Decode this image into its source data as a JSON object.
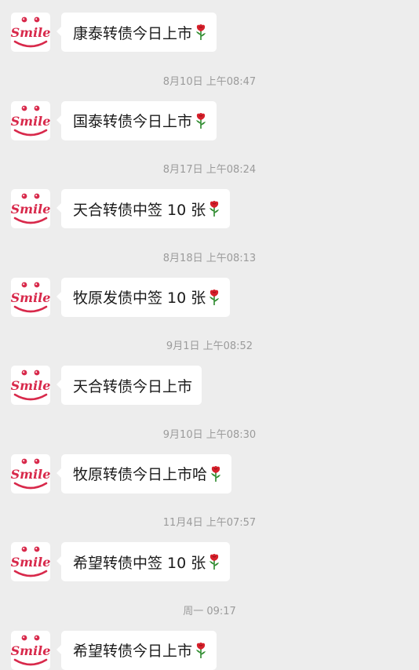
{
  "avatar": {
    "text": "Smile"
  },
  "colors": {
    "background": "#ededed",
    "bubble": "#ffffff",
    "text": "#1a1a1a",
    "timestamp": "#9b9b9b",
    "brand": "#d8294b",
    "rose": "#d6202b",
    "leaf": "#2e8b2e"
  },
  "messages": [
    {
      "text": "康泰转债今日上市",
      "rose": true
    },
    {
      "timestamp": "8月10日 上午08:47",
      "text": "国泰转债今日上市",
      "rose": true
    },
    {
      "timestamp": "8月17日 上午08:24",
      "text": "天合转债中签 10 张",
      "rose": true
    },
    {
      "timestamp": "8月18日 上午08:13",
      "text": "牧原发债中签 10 张",
      "rose": true
    },
    {
      "timestamp": "9月1日 上午08:52",
      "text": "天合转债今日上市",
      "rose": false
    },
    {
      "timestamp": "9月10日 上午08:30",
      "text": "牧原转债今日上市哈",
      "rose": true
    },
    {
      "timestamp": "11月4日 上午07:57",
      "text": "希望转债中签 10 张",
      "rose": true
    },
    {
      "timestamp": "周一 09:17",
      "text": "希望转债今日上市",
      "rose": true
    }
  ]
}
